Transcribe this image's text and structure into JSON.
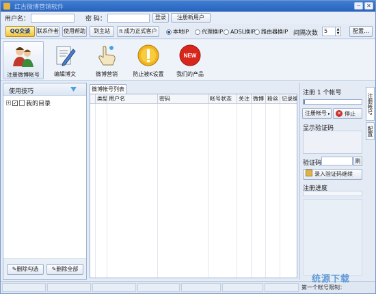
{
  "window": {
    "title": "红古微博营销软件"
  },
  "login": {
    "username_label": "用户名：",
    "username_value": "",
    "password_label": "密 码：",
    "password_value": "",
    "login_button": "登录",
    "register_button": "注册新用户"
  },
  "toolbar2": {
    "qq_button": "QQ交谈",
    "contact_button": "联系作者",
    "help_button": "使用帮助",
    "home_button": "到主站",
    "upgrade_button": "成为正式客户",
    "radio_options": [
      {
        "label": "本地IP",
        "selected": true
      },
      {
        "label": "代理换IP",
        "selected": false
      },
      {
        "label": "ADSL换IP",
        "selected": false
      },
      {
        "label": "路由器换IP",
        "selected": false
      }
    ],
    "interval_label": "间隔次数",
    "interval_value": "5",
    "config_button": "配置..."
  },
  "main_tools": [
    {
      "label": "注册微博帐号",
      "icon": "users-icon",
      "active": true
    },
    {
      "label": "编辑博文",
      "icon": "edit-document-icon",
      "active": false
    },
    {
      "label": "微博营销",
      "icon": "pointer-hand-icon",
      "active": false
    },
    {
      "label": "防止被K设置",
      "icon": "key-icon",
      "active": false
    },
    {
      "label": "我们的产品",
      "icon": "new-badge-icon",
      "active": false
    }
  ],
  "left_panel": {
    "title": "使用技巧",
    "tree_item": "我的目录",
    "delete_checked_button": "删除勾选",
    "delete_all_button": "删除全部"
  },
  "center_panel": {
    "tab_label": "微博帐号列表",
    "columns": [
      "类型",
      "用户名",
      "密码",
      "帐号状态",
      "关注",
      "微博",
      "粉丝",
      "记录编号"
    ]
  },
  "right_panel": {
    "title": "注册 1 个帐号",
    "register_select": "注册帐号",
    "stop_button": "停止",
    "captcha_display_label": "显示验证码",
    "captcha_label": "验证码",
    "captcha_value": "",
    "refresh_button": "刷",
    "submit_captcha_button": "录入验证码继续",
    "progress_label": "注册进度",
    "progress": 0
  },
  "side_tabs": [
    "注册帐号",
    "配置"
  ],
  "status": {
    "text": "第一个帐号限制："
  },
  "watermark": "统源下载",
  "colors": {
    "titlebar": "#2a62bb",
    "panel_bg": "#e4ebf5",
    "accent": "#4c8fd1"
  }
}
